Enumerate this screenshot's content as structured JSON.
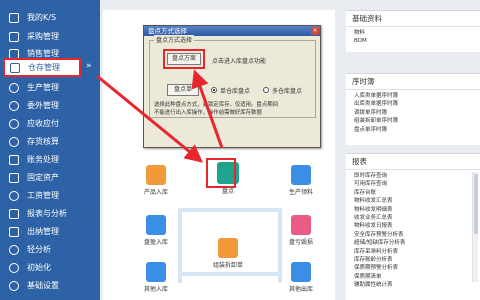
{
  "sidebar": {
    "items": [
      {
        "label": "我的K/S",
        "icon": "home-icon"
      },
      {
        "label": "采购管理",
        "icon": "cart-icon"
      },
      {
        "label": "销售管理",
        "icon": "sales-icon"
      },
      {
        "label": "仓存管理",
        "icon": "warehouse-icon"
      },
      {
        "label": "生产管理",
        "icon": "gear-icon"
      },
      {
        "label": "委外管理",
        "icon": "outsource-icon"
      },
      {
        "label": "应收应付",
        "icon": "money-icon"
      },
      {
        "label": "存货核算",
        "icon": "calculate-icon"
      },
      {
        "label": "账务处理",
        "icon": "ledger-icon"
      },
      {
        "label": "固定资产",
        "icon": "asset-icon"
      },
      {
        "label": "工资管理",
        "icon": "salary-icon"
      },
      {
        "label": "报表与分析",
        "icon": "report-icon"
      },
      {
        "label": "出纳管理",
        "icon": "cashier-icon"
      },
      {
        "label": "轻分析",
        "icon": "analysis-icon"
      },
      {
        "label": "初始化",
        "icon": "init-icon"
      },
      {
        "label": "基础设置",
        "icon": "settings-icon"
      }
    ],
    "active_label": "仓存管理"
  },
  "main": {
    "nodes": [
      {
        "label": "产品入库",
        "color": "#f29a3a"
      },
      {
        "label": "盘点",
        "color": "#1fa38d"
      },
      {
        "label": "生产领料",
        "color": "#3a8ee6"
      },
      {
        "label": "盘盈入库",
        "color": "#3a8ee6"
      },
      {
        "label": "盘亏毁损",
        "color": "#ec5a86"
      },
      {
        "label": "组装拆卸单",
        "color": "#f29a3a"
      },
      {
        "label": "其他入库",
        "color": "#3a8ee6"
      },
      {
        "label": "其他出库",
        "color": "#3a8ee6"
      }
    ]
  },
  "dialog": {
    "title": "盘点方式选择",
    "close": "×",
    "group_label": "盘点方式选择",
    "plan_button": "盘点方案",
    "plan_hint": "点击进入库盘点功能",
    "data_button": "盘点单",
    "radio_single": "单仓库盘点",
    "radio_multi": "多仓库盘点",
    "note_line1": "选择此种盘点方式，会锁定库存，仅适用。盘点期间",
    "note_line2": "不能进行出入库操作，操作前需做好库存数据"
  },
  "panels": {
    "basic": {
      "title": "基础资料",
      "rows": [
        "物料",
        "BOM"
      ]
    },
    "sequence": {
      "title": "序时簿",
      "rows": [
        "入库类单据序时簿",
        "出库类单据序时簿",
        "调拨单序时簿",
        "组装拆卸单序时簿",
        "盘点单序时簿"
      ]
    },
    "reports": {
      "title": "报表",
      "rows": [
        "即时库存查询",
        "可用库存查询",
        "库存台账",
        "物料收发汇总表",
        "物料收发明细表",
        "收发业务汇总表",
        "物料收发日报表",
        "安全库存预警分析表",
        "超储/短缺库存分析表",
        "库存呆滞料分析表",
        "库存账龄分析表",
        "保质期预警分析表",
        "保质期清单",
        "辅助属性统计表"
      ]
    }
  }
}
